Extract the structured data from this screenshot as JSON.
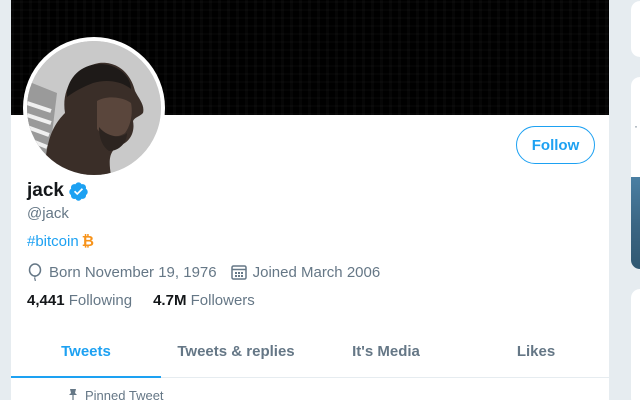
{
  "profile": {
    "display_name": "jack",
    "handle": "@jack",
    "bio": {
      "hashtag": "#bitcoin",
      "emoji": "₿"
    },
    "born": "Born November 19, 1976",
    "joined": "Joined March 2006",
    "following": {
      "count": "4,441",
      "label": "Following"
    },
    "followers": {
      "count": "4.7M",
      "label": "Followers"
    },
    "follow_label": "Follow"
  },
  "tabs": [
    {
      "label": "Tweets",
      "active": true
    },
    {
      "label": "Tweets & replies",
      "active": false
    },
    {
      "label": "It's Media",
      "active": false
    },
    {
      "label": "Likes",
      "active": false
    }
  ],
  "pinned_label": "Pinned Tweet",
  "colors": {
    "accent": "#1da1f2",
    "text": "#14171a",
    "muted": "#657786",
    "bitcoin": "#f7931a"
  },
  "icons": {
    "verified": "verified-badge-icon",
    "born": "balloon-icon",
    "joined": "calendar-icon",
    "pinned": "pin-icon"
  }
}
